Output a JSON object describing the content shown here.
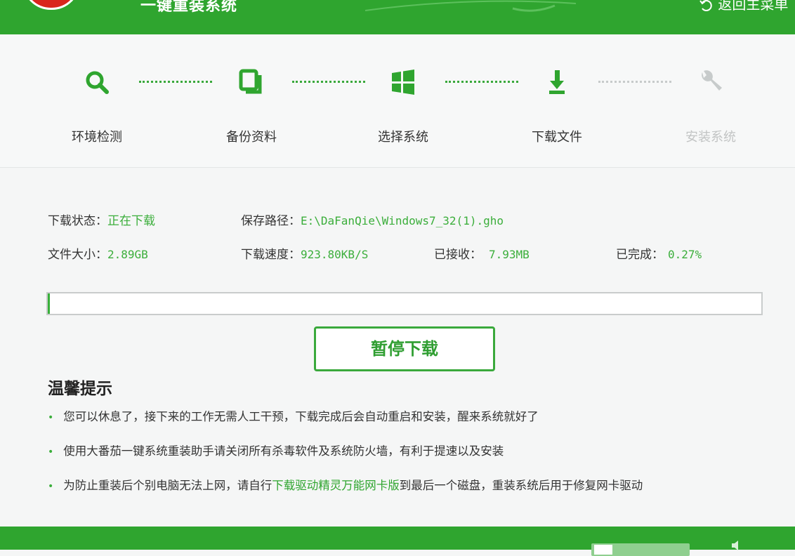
{
  "header": {
    "title": "一键重装系统",
    "back_label": "返回主菜单"
  },
  "steps": [
    {
      "label": "环境检测",
      "icon": "search-icon",
      "state": "done"
    },
    {
      "label": "备份资料",
      "icon": "copy-icon",
      "state": "done"
    },
    {
      "label": "选择系统",
      "icon": "windows-icon",
      "state": "done"
    },
    {
      "label": "下载文件",
      "icon": "download-icon",
      "state": "active"
    },
    {
      "label": "安装系统",
      "icon": "wrench-icon",
      "state": "pending"
    }
  ],
  "download": {
    "status_label": "下载状态：",
    "status_value": "正在下载",
    "path_label": "保存路径：",
    "path_value": "E:\\DaFanQie\\Windows7_32(1).gho",
    "size_label": "文件大小：",
    "size_value": "2.89GB",
    "speed_label": "下载速度：",
    "speed_value": "923.80KB/S",
    "received_label": "已接收：",
    "received_value": "7.93MB",
    "done_label": "已完成：",
    "done_value": "0.27%",
    "progress": 0.0027
  },
  "pause_button": "暂停下载",
  "tips": {
    "title": "温馨提示",
    "items": [
      {
        "text": "您可以休息了，接下来的工作无需人工干预，下载完成后会自动重启和安装，醒来系统就好了"
      },
      {
        "text": "使用大番茄一键系统重装助手请关闭所有杀毒软件及系统防火墙，有利于提速以及安装"
      },
      {
        "before": "为防止重装后个别电脑无法上网，请自行",
        "link": "下载驱动精灵万能网卡版",
        "after": "到最后一个磁盘，重装系统后用于修复网卡驱动"
      }
    ]
  },
  "colors": {
    "brand": "#2fa52f",
    "accent_text": "#3bae3b",
    "pending": "#c2c4c4"
  }
}
